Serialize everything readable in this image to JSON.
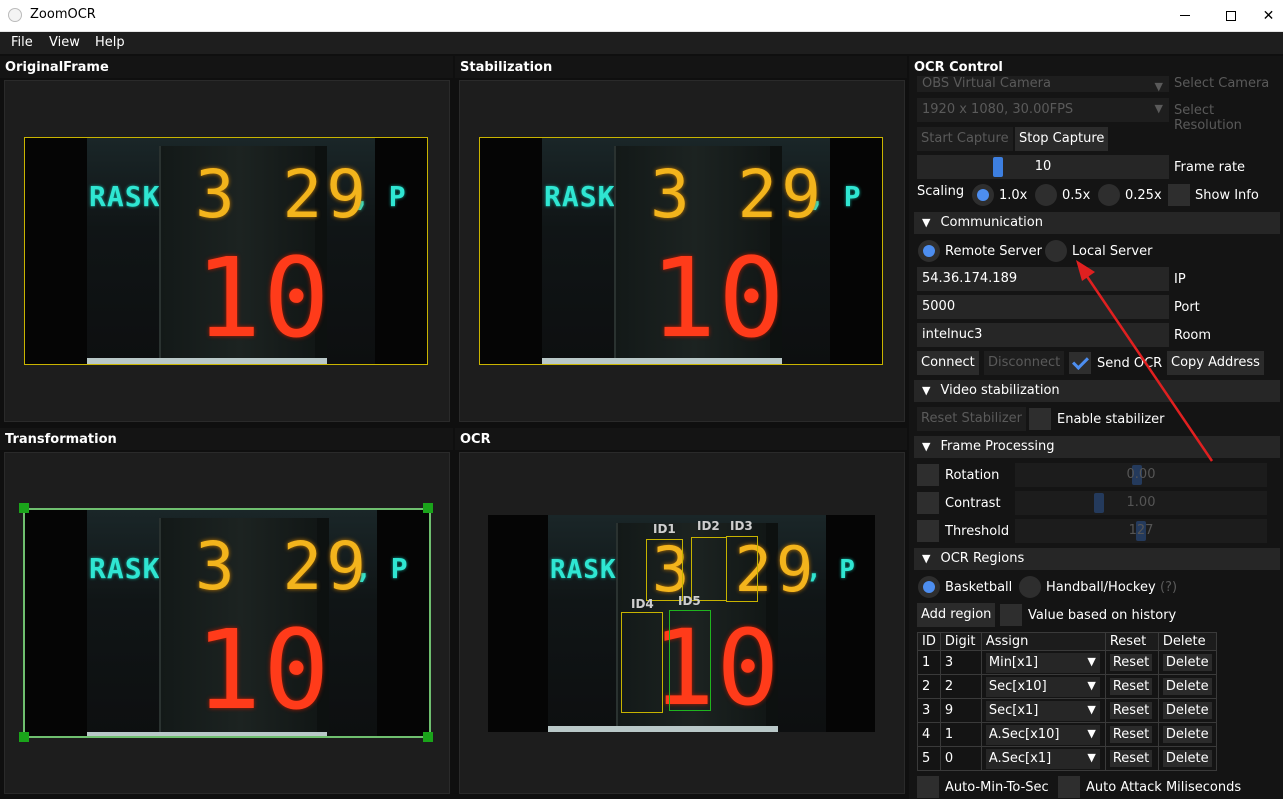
{
  "window": {
    "title": "ZoomOCR"
  },
  "menu": [
    "File",
    "View",
    "Help"
  ],
  "panels": {
    "original": "OriginalFrame",
    "stabilization": "Stabilization",
    "transformation": "Transformation",
    "ocr": "OCR"
  },
  "scene": {
    "ask_text": "RASK",
    "right_text": ", P",
    "shot_time": "3 29",
    "game_num": "10"
  },
  "ocr_labels": [
    "ID1",
    "ID2",
    "ID3",
    "ID4",
    "ID5"
  ],
  "control": {
    "title": "OCR Control",
    "camera": {
      "value": "OBS Virtual Camera",
      "label": "Select Camera"
    },
    "resolution": {
      "value": "1920 x 1080, 30.00FPS",
      "label": "Select Resolution"
    },
    "start_capture": "Start Capture",
    "stop_capture": "Stop Capture",
    "frame_rate": {
      "value": "10",
      "label": "Frame rate"
    },
    "scaling": {
      "label": "Scaling",
      "options": [
        "1.0x",
        "0.5x",
        "0.25x"
      ],
      "selected": "1.0x"
    },
    "show_info": "Show Info",
    "communication": {
      "title": "Communication",
      "remote": "Remote Server",
      "local": "Local Server",
      "ip": {
        "value": "54.36.174.189",
        "label": "IP"
      },
      "port": {
        "value": "5000",
        "label": "Port"
      },
      "room": {
        "value": "intelnuc3",
        "label": "Room"
      },
      "connect": "Connect",
      "disconnect": "Disconnect",
      "send_ocr": "Send OCR",
      "copy_address": "Copy Address"
    },
    "video_stab": {
      "title": "Video stabilization",
      "reset": "Reset Stabilizer",
      "enable": "Enable stabilizer"
    },
    "frame_processing": {
      "title": "Frame Processing",
      "rotation": {
        "label": "Rotation",
        "value": "0.00"
      },
      "contrast": {
        "label": "Contrast",
        "value": "1.00"
      },
      "threshold": {
        "label": "Threshold",
        "value": "127"
      }
    },
    "ocr_regions": {
      "title": "OCR Regions",
      "basketball": "Basketball",
      "handball": "Handball/Hockey",
      "help": "(?)",
      "add_region": "Add region",
      "value_history": "Value based on history",
      "columns": [
        "ID",
        "Digit",
        "Assign",
        "Reset",
        "Delete"
      ],
      "rows": [
        {
          "id": "1",
          "digit": "3",
          "assign": "Min[x1]"
        },
        {
          "id": "2",
          "digit": "2",
          "assign": "Sec[x10]"
        },
        {
          "id": "3",
          "digit": "9",
          "assign": "Sec[x1]"
        },
        {
          "id": "4",
          "digit": "1",
          "assign": "A.Sec[x10]"
        },
        {
          "id": "5",
          "digit": "0",
          "assign": "A.Sec[x1]"
        }
      ],
      "reset_label": "Reset",
      "delete_label": "Delete",
      "auto_min": "Auto-Min-To-Sec",
      "auto_attack": "Auto Attack Miliseconds"
    }
  },
  "colors": {
    "accent": "#4d8ef0",
    "roi_yellow": "#c9b400",
    "roi_green": "#6fbf6f",
    "annotation_arrow": "#e02020"
  }
}
